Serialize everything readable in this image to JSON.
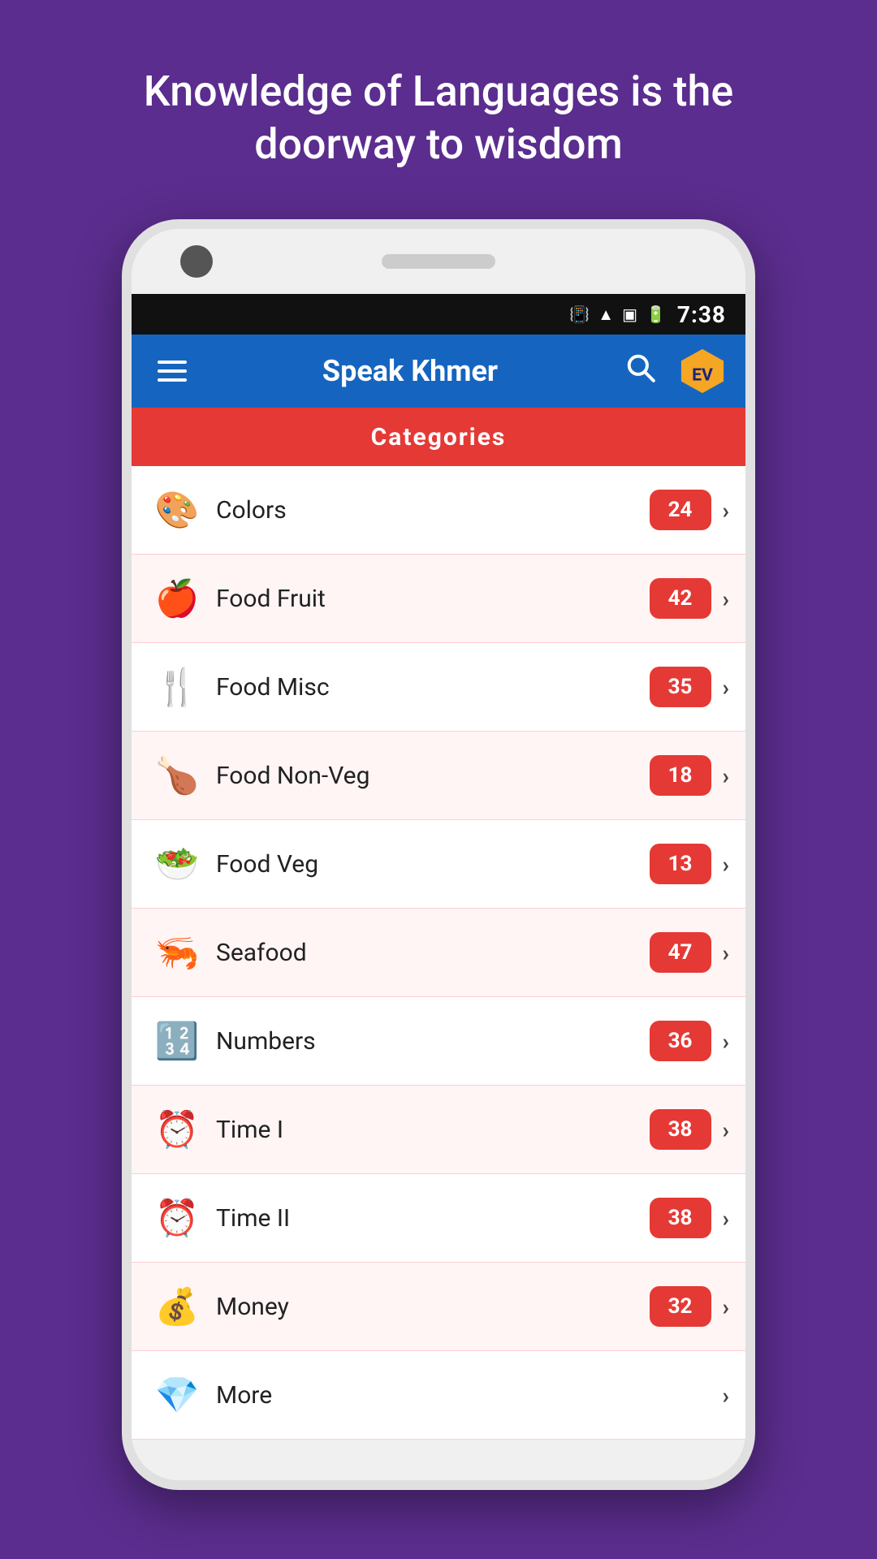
{
  "hero": {
    "text": "Knowledge of Languages is the doorway to wisdom"
  },
  "statusBar": {
    "time": "7:38",
    "icons": [
      "vibrate",
      "wifi",
      "signal",
      "battery"
    ]
  },
  "appBar": {
    "title": "Speak Khmer",
    "searchLabel": "Search",
    "evLabel": "EV"
  },
  "categoriesHeader": {
    "label": "Categories"
  },
  "categories": [
    {
      "name": "Colors",
      "count": "24",
      "icon": "🎨"
    },
    {
      "name": "Food Fruit",
      "count": "42",
      "icon": "🍎"
    },
    {
      "name": "Food Misc",
      "count": "35",
      "icon": "🍴"
    },
    {
      "name": "Food Non-Veg",
      "count": "18",
      "icon": "🍗"
    },
    {
      "name": "Food Veg",
      "count": "13",
      "icon": "🥗"
    },
    {
      "name": "Seafood",
      "count": "47",
      "icon": "🦐"
    },
    {
      "name": "Numbers",
      "count": "36",
      "icon": "🔢"
    },
    {
      "name": "Time I",
      "count": "38",
      "icon": "⏰"
    },
    {
      "name": "Time II",
      "count": "38",
      "icon": "⏰"
    },
    {
      "name": "Money",
      "count": "32",
      "icon": "💰"
    },
    {
      "name": "More",
      "count": "",
      "icon": "💎"
    }
  ]
}
